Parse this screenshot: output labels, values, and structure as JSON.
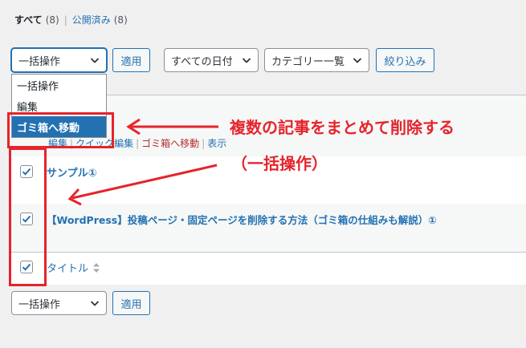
{
  "subsubsub": {
    "all_label": "すべて",
    "all_count": "(8)",
    "separator": "|",
    "published_label": "公開済み",
    "published_count": "(8)"
  },
  "toolbar": {
    "bulk_action_value": "一括操作",
    "apply_label": "適用",
    "date_filter_value": "すべての日付",
    "category_filter_value": "カテゴリー一覧",
    "filter_label": "絞り込み"
  },
  "bulk_dropdown": {
    "options": [
      "一括操作",
      "編集",
      "ゴミ箱へ移動"
    ],
    "highlighted": "ゴミ箱へ移動"
  },
  "row_actions": {
    "edit": "編集",
    "quick_edit": "クイック編集",
    "trash": "ゴミ箱へ移動",
    "view": "表示",
    "separator": "|"
  },
  "posts": [
    {
      "title": "サンプル①",
      "checked": true
    },
    {
      "title": "【WordPress】投稿ページ・固定ページを削除する方法（ゴミ箱の仕組みも解説）①",
      "checked": true
    }
  ],
  "footer_header": {
    "column_title": "タイトル",
    "checked": true
  },
  "bottom_toolbar": {
    "bulk_action_value": "一括操作",
    "apply_label": "適用"
  },
  "annotation": {
    "line1": "複数の記事をまとめて削除する",
    "line2": "（一括操作）",
    "color": "#e5242c"
  },
  "colors": {
    "accent": "#2271b1",
    "danger": "#b32d2e",
    "annotation": "#e5242c"
  }
}
